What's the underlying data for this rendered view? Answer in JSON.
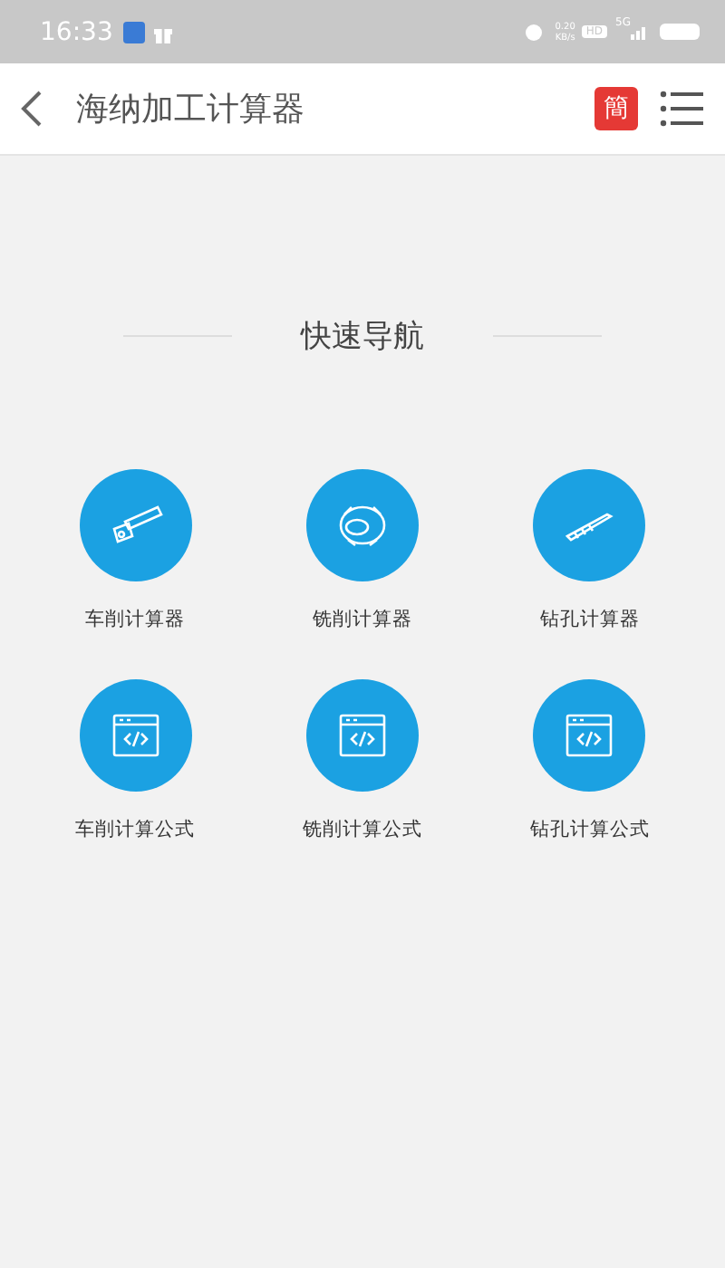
{
  "status_bar": {
    "time": "16:33",
    "net_speed": "0.20",
    "net_unit": "KB/s",
    "hd": "HD",
    "network": "5G"
  },
  "header": {
    "title": "海纳加工计算器",
    "lang_badge": "簡"
  },
  "section": {
    "title": "快速导航"
  },
  "items": [
    {
      "label": "车削计算器",
      "kind": "turning"
    },
    {
      "label": "铣削计算器",
      "kind": "milling"
    },
    {
      "label": "钻孔计算器",
      "kind": "drilling"
    },
    {
      "label": "车削计算公式",
      "kind": "formula"
    },
    {
      "label": "铣削计算公式",
      "kind": "formula"
    },
    {
      "label": "钻孔计算公式",
      "kind": "formula"
    }
  ]
}
